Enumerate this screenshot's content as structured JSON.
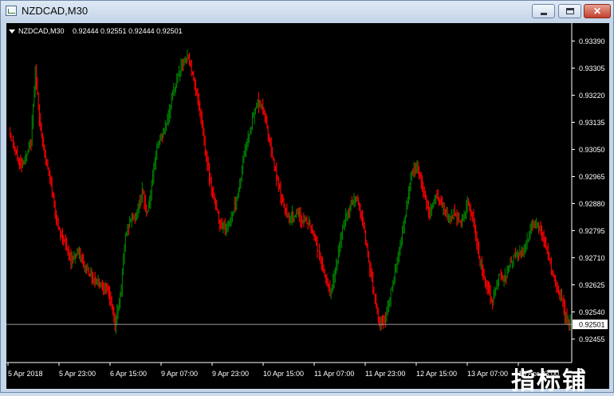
{
  "window": {
    "title": "NZDCAD,M30",
    "minimize_label": "—",
    "maximize_label": "□",
    "close_label": "✕"
  },
  "chart_header": {
    "symbol": "NZDCAD,M30",
    "ohlc": "0.92444 0.92551 0.92444 0.92501"
  },
  "current_price": "0.92501",
  "watermark": "指标铺",
  "colors": {
    "up": "#008000",
    "down": "#ff0000",
    "background": "#000000",
    "grid_text": "#ffffff"
  },
  "chart_data": {
    "type": "candlestick",
    "symbol": "NZDCAD",
    "timeframe": "M30",
    "y_ticks": [
      "0.93390",
      "0.93305",
      "0.93220",
      "0.93135",
      "0.93050",
      "0.92965",
      "0.92880",
      "0.92795",
      "0.92710",
      "0.92625",
      "0.92540",
      "0.92455"
    ],
    "ylim": [
      0.9242,
      0.9346
    ],
    "x_ticks": [
      "5 Apr 2018",
      "5 Apr 23:00",
      "6 Apr 15:00",
      "9 Apr 07:00",
      "9 Apr 23:00",
      "10 Apr 15:00",
      "11 Apr 07:00",
      "11 Apr 23:00",
      "12 Apr 15:00",
      "13 Apr 07:00",
      "13 Apr 23:00"
    ],
    "current_price": 0.92501,
    "path": [
      [
        0,
        0.9312
      ],
      [
        3,
        0.9305
      ],
      [
        6,
        0.93
      ],
      [
        9,
        0.9303
      ],
      [
        11,
        0.9307
      ],
      [
        13,
        0.933
      ],
      [
        15,
        0.9314
      ],
      [
        18,
        0.9302
      ],
      [
        21,
        0.9292
      ],
      [
        24,
        0.928
      ],
      [
        27,
        0.9276
      ],
      [
        30,
        0.927
      ],
      [
        33,
        0.9273
      ],
      [
        36,
        0.9269
      ],
      [
        40,
        0.9265
      ],
      [
        44,
        0.9263
      ],
      [
        48,
        0.926
      ],
      [
        51,
        0.925
      ],
      [
        54,
        0.9262
      ],
      [
        56,
        0.9278
      ],
      [
        59,
        0.9284
      ],
      [
        61,
        0.9284
      ],
      [
        64,
        0.9292
      ],
      [
        66,
        0.9285
      ],
      [
        68,
        0.929
      ],
      [
        71,
        0.9306
      ],
      [
        74,
        0.931
      ],
      [
        77,
        0.9317
      ],
      [
        80,
        0.9326
      ],
      [
        83,
        0.9332
      ],
      [
        86,
        0.9334
      ],
      [
        89,
        0.9326
      ],
      [
        92,
        0.9315
      ],
      [
        95,
        0.93
      ],
      [
        98,
        0.929
      ],
      [
        101,
        0.9282
      ],
      [
        104,
        0.928
      ],
      [
        107,
        0.9285
      ],
      [
        110,
        0.9292
      ],
      [
        113,
        0.9305
      ],
      [
        116,
        0.9313
      ],
      [
        119,
        0.932
      ],
      [
        122,
        0.9317
      ],
      [
        125,
        0.9307
      ],
      [
        128,
        0.9296
      ],
      [
        131,
        0.9288
      ],
      [
        134,
        0.9283
      ],
      [
        137,
        0.9285
      ],
      [
        140,
        0.9283
      ],
      [
        143,
        0.9282
      ],
      [
        146,
        0.9278
      ],
      [
        149,
        0.927
      ],
      [
        152,
        0.9263
      ],
      [
        154,
        0.926
      ],
      [
        157,
        0.927
      ],
      [
        160,
        0.9282
      ],
      [
        163,
        0.9287
      ],
      [
        166,
        0.929
      ],
      [
        169,
        0.9283
      ],
      [
        172,
        0.927
      ],
      [
        175,
        0.9258
      ],
      [
        177,
        0.925
      ],
      [
        180,
        0.9252
      ],
      [
        183,
        0.9262
      ],
      [
        186,
        0.9272
      ],
      [
        189,
        0.9282
      ],
      [
        192,
        0.9296
      ],
      [
        195,
        0.93
      ],
      [
        198,
        0.9292
      ],
      [
        201,
        0.9285
      ],
      [
        204,
        0.929
      ],
      [
        207,
        0.9287
      ],
      [
        210,
        0.9283
      ],
      [
        213,
        0.9285
      ],
      [
        216,
        0.9282
      ],
      [
        219,
        0.9288
      ],
      [
        222,
        0.9282
      ],
      [
        225,
        0.927
      ],
      [
        228,
        0.9263
      ],
      [
        231,
        0.9257
      ],
      [
        234,
        0.9265
      ],
      [
        237,
        0.9265
      ],
      [
        240,
        0.927
      ],
      [
        243,
        0.9272
      ],
      [
        246,
        0.9273
      ],
      [
        249,
        0.928
      ],
      [
        252,
        0.9282
      ],
      [
        255,
        0.9278
      ],
      [
        258,
        0.927
      ],
      [
        261,
        0.9262
      ],
      [
        264,
        0.9258
      ],
      [
        266,
        0.9252
      ],
      [
        268,
        0.925
      ]
    ]
  }
}
